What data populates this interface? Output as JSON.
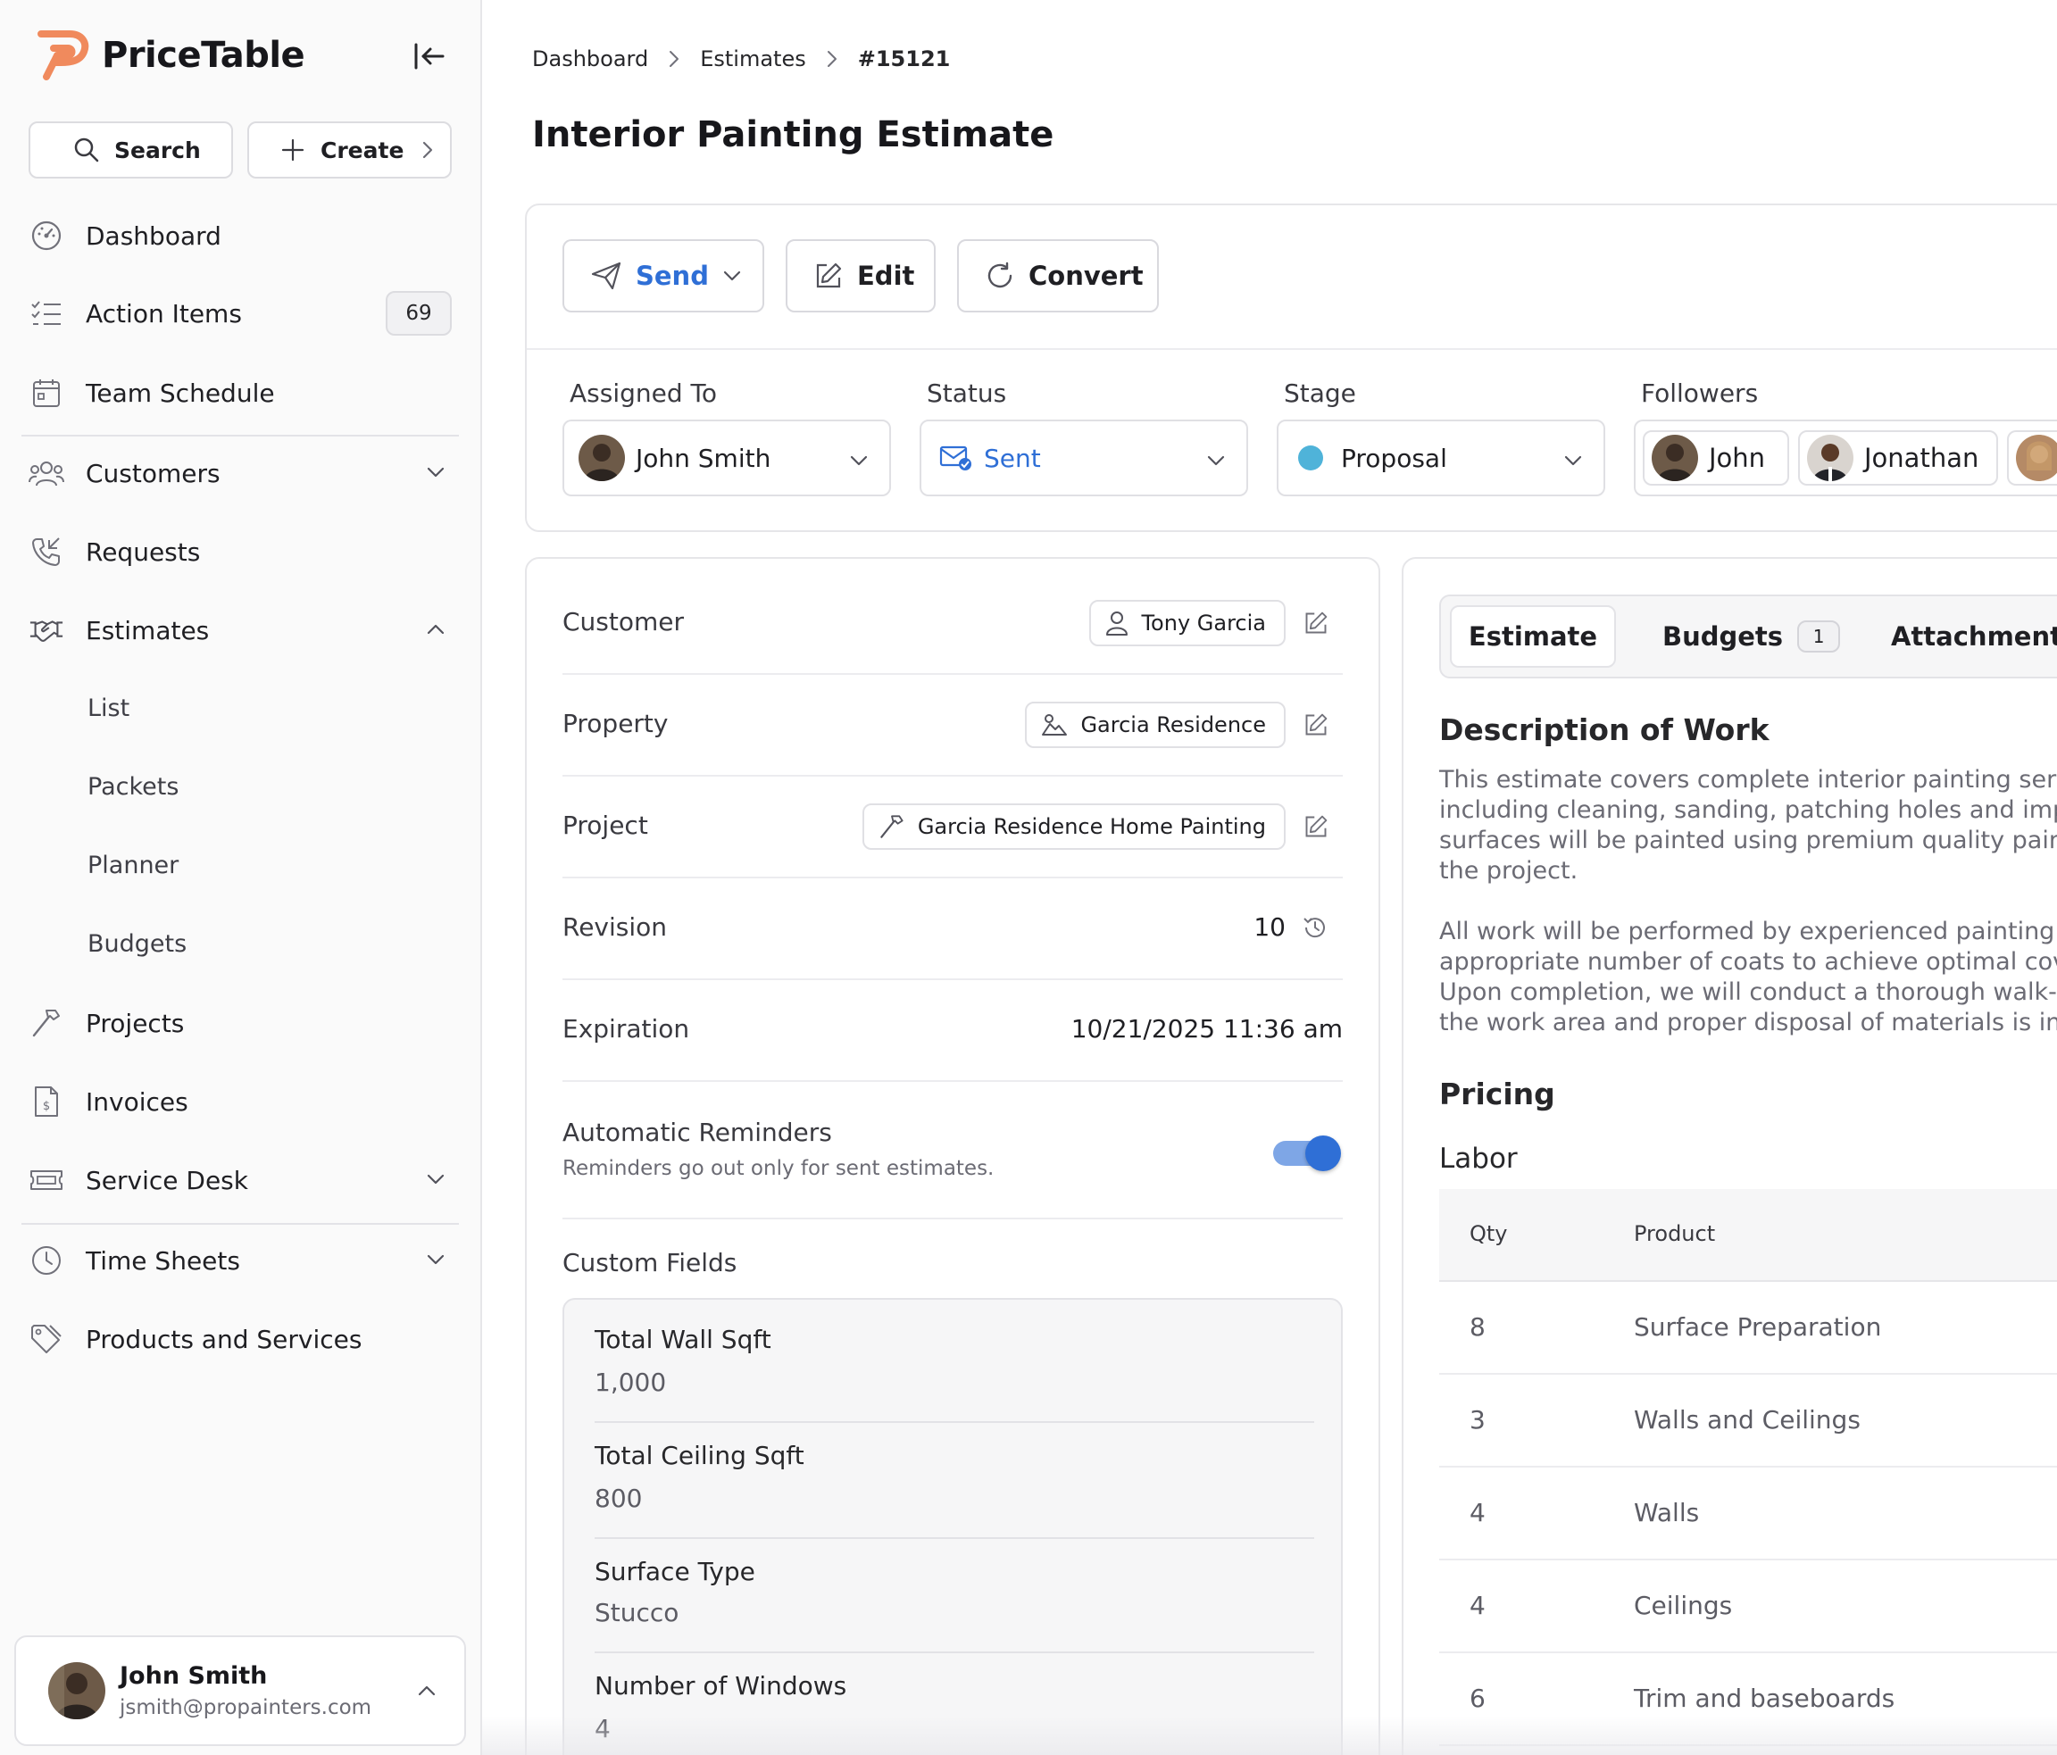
{
  "app": {
    "name": "PriceTable",
    "brand_color": "#f08a5d",
    "accent_color": "#2f6fd6"
  },
  "sidebar": {
    "search_label": "Search",
    "create_label": "Create",
    "items": [
      {
        "label": "Dashboard",
        "icon": "dashboard-icon"
      },
      {
        "label": "Action Items",
        "icon": "checklist-icon",
        "badge": "69"
      },
      {
        "label": "Team Schedule",
        "icon": "calendar-icon"
      },
      {
        "label": "Customers",
        "icon": "users-icon"
      },
      {
        "label": "Requests",
        "icon": "phone-icon"
      },
      {
        "label": "Estimates",
        "icon": "handshake-icon",
        "expanded": true,
        "children": [
          "List",
          "Packets",
          "Planner",
          "Budgets"
        ]
      },
      {
        "label": "Projects",
        "icon": "hammer-icon"
      },
      {
        "label": "Invoices",
        "icon": "invoice-icon"
      },
      {
        "label": "Service Desk",
        "icon": "ticket-icon"
      },
      {
        "label": "Time Sheets",
        "icon": "clock-icon"
      },
      {
        "label": "Products and Services",
        "icon": "tag-icon"
      }
    ],
    "user": {
      "name": "John Smith",
      "email": "jsmith@propainters.com"
    }
  },
  "breadcrumb": [
    "Dashboard",
    "Estimates",
    "#15121"
  ],
  "page_title": "Interior Painting Estimate",
  "actions": {
    "send": "Send",
    "edit": "Edit",
    "convert": "Convert"
  },
  "meta": {
    "assigned_to_label": "Assigned To",
    "assigned_to": "John Smith",
    "status_label": "Status",
    "status": "Sent",
    "stage_label": "Stage",
    "stage": "Proposal",
    "stage_color": "#4fb3d9",
    "followers_label": "Followers",
    "followers": [
      "John",
      "Jonathan"
    ]
  },
  "details": {
    "customer_label": "Customer",
    "customer": "Tony Garcia",
    "property_label": "Property",
    "property": "Garcia Residence",
    "project_label": "Project",
    "project": "Garcia Residence Home Painting",
    "revision_label": "Revision",
    "revision": "10",
    "expiration_label": "Expiration",
    "expiration": "10/21/2025 11:36 am",
    "reminders_label": "Automatic Reminders",
    "reminders_help": "Reminders go out only for sent estimates.",
    "reminders_on": true
  },
  "custom_fields": {
    "title": "Custom Fields",
    "items": [
      {
        "label": "Total Wall Sqft",
        "value": "1,000"
      },
      {
        "label": "Total Ceiling Sqft",
        "value": "800"
      },
      {
        "label": "Surface Type",
        "value": "Stucco"
      },
      {
        "label": "Number of Windows",
        "value": "4"
      }
    ]
  },
  "tabs": [
    {
      "label": "Estimate",
      "active": true
    },
    {
      "label": "Budgets",
      "count": "1"
    },
    {
      "label": "Attachments"
    }
  ],
  "description": {
    "title": "Description of Work",
    "lines": [
      "This estimate covers complete interior painting servi",
      "including cleaning, sanding, patching holes and impe",
      "surfaces will be painted using premium quality paints",
      "the project.",
      "All work will be performed by experienced painting p",
      "appropriate number of coats to achieve optimal cove",
      "Upon completion, we will conduct a thorough walk-th",
      "the work area and proper disposal of materials is inc"
    ]
  },
  "pricing": {
    "title": "Pricing",
    "labor_title": "Labor",
    "columns": [
      "Qty",
      "Product"
    ],
    "rows": [
      {
        "qty": "8",
        "product": "Surface Preparation"
      },
      {
        "qty": "3",
        "product": "Walls and Ceilings"
      },
      {
        "qty": "4",
        "product": "Walls"
      },
      {
        "qty": "4",
        "product": "Ceilings"
      },
      {
        "qty": "6",
        "product": "Trim and baseboards"
      }
    ]
  }
}
